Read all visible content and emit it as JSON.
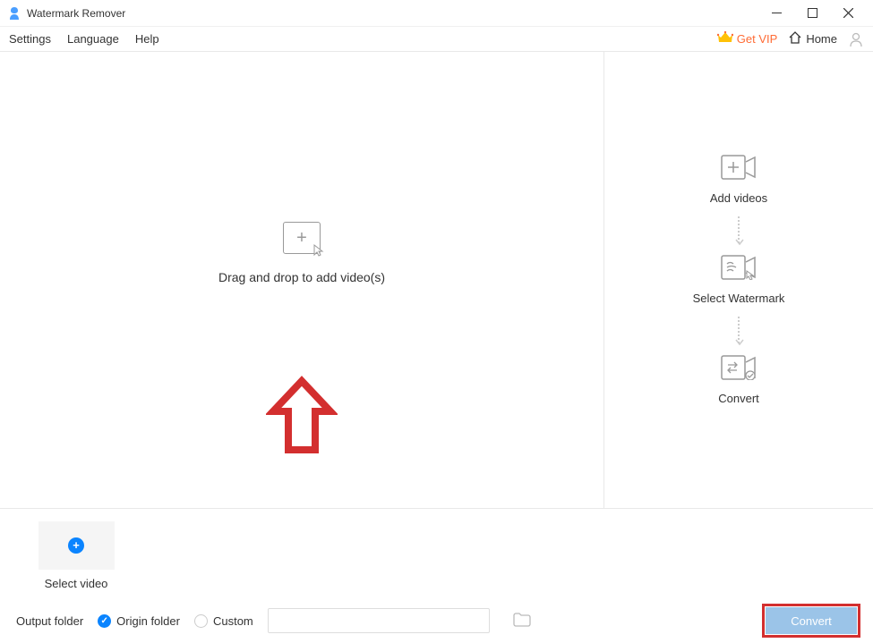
{
  "titlebar": {
    "app_title": "Watermark Remover"
  },
  "menubar": {
    "items": [
      "Settings",
      "Language",
      "Help"
    ],
    "vip_label": "Get VIP",
    "home_label": "Home"
  },
  "drop_zone": {
    "text": "Drag and drop to add video(s)"
  },
  "steps": {
    "add": "Add videos",
    "select": "Select Watermark",
    "convert": "Convert"
  },
  "bottom": {
    "select_video_label": "Select video"
  },
  "footer": {
    "output_label": "Output folder",
    "origin_label": "Origin folder",
    "custom_label": "Custom",
    "path_value": "",
    "convert_label": "Convert"
  }
}
